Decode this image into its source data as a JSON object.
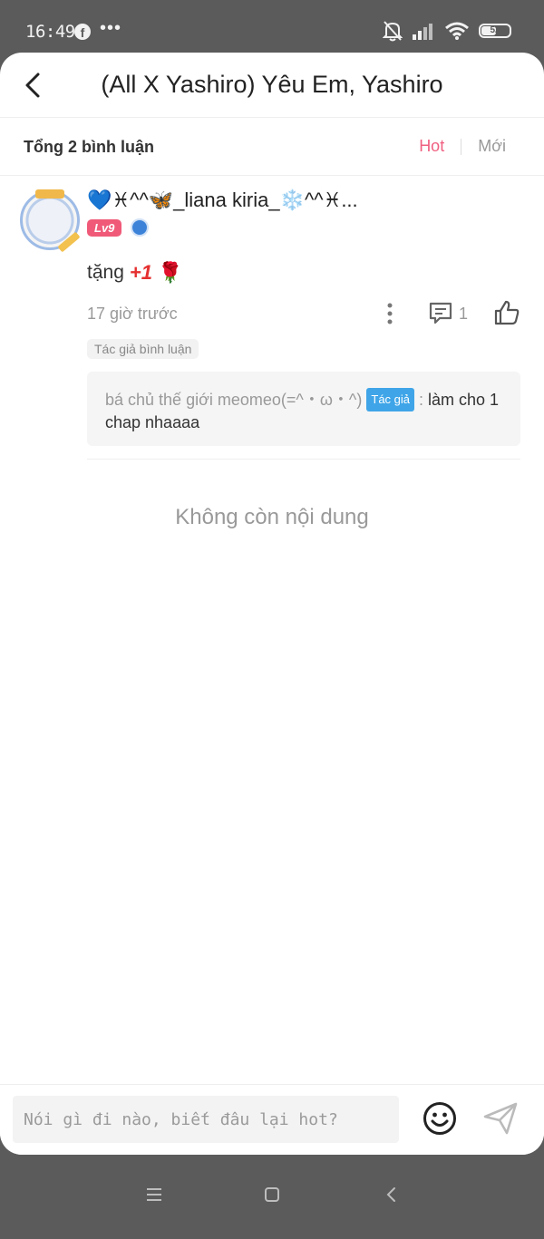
{
  "status_bar": {
    "time": "16:49",
    "battery": "52",
    "icons": [
      "facebook-icon",
      "more-dots-icon",
      "bell-off-icon",
      "signal-icon",
      "wifi-icon",
      "battery-icon"
    ]
  },
  "header": {
    "title": "(All X Yashiro) Yêu Em, Yashiro",
    "back_icon": "chevron-left-icon"
  },
  "summary": {
    "total": "Tổng 2 bình luận",
    "tabs": [
      {
        "label": "Hot",
        "active": true,
        "color": "#f06080"
      },
      {
        "label": "Mới",
        "active": false
      }
    ]
  },
  "comment": {
    "user_name": "💙♓^^🦋_liana kiria_❄️^^♓...",
    "level": "Lv9",
    "text": "tặng",
    "plus": "+1",
    "rose": "🌹",
    "time_ago": "17 giờ trước",
    "reply_count": "1",
    "author_tag": "Tác giả bình luận",
    "reply": {
      "author": "bá chủ thế giới meomeo(=^・ω・^)",
      "badge": "Tác giả",
      "colon": " : ",
      "text": "làm cho 1 chap nhaaaa"
    }
  },
  "no_more": "Không còn nội dung",
  "composer": {
    "placeholder": "Nói gì đi nào, biết đâu lại hot?"
  },
  "nav": [
    "menu-icon",
    "home-square-icon",
    "back-triangle-icon"
  ]
}
